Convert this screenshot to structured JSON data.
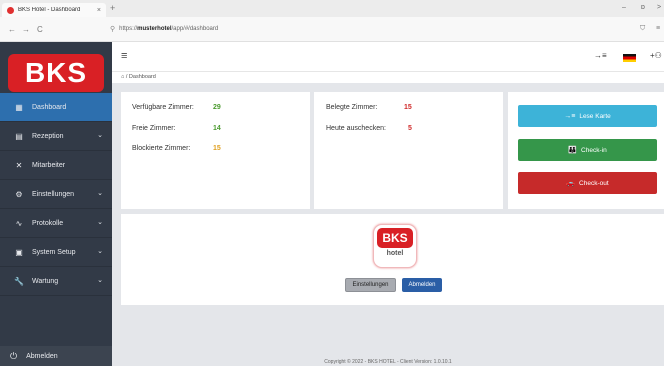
{
  "browser": {
    "tab_title": "BKS Hotel - Dashboard",
    "tab_close": "×",
    "new_tab": "+",
    "url_prefix": "https://",
    "url_host": "musterhotel",
    "url_path": "/app/#/dashboard",
    "back": "←",
    "forward": "→",
    "reload": "C",
    "minimize": "–",
    "restore": "ɒ",
    "close": ">",
    "shield": "⛉",
    "menu": "≡"
  },
  "sidebar": {
    "logo_text": "BKS",
    "items": [
      {
        "label": "Dashboard",
        "icon": "▦",
        "has_children": false,
        "active": true
      },
      {
        "label": "Rezeption",
        "icon": "▤",
        "has_children": true,
        "active": false
      },
      {
        "label": "Mitarbeiter",
        "icon": "✕",
        "has_children": false,
        "active": false
      },
      {
        "label": "Einstellungen",
        "icon": "⚙",
        "has_children": true,
        "active": false
      },
      {
        "label": "Protokolle",
        "icon": "∿",
        "has_children": true,
        "active": false
      },
      {
        "label": "System Setup",
        "icon": "▣",
        "has_children": true,
        "active": false
      },
      {
        "label": "Wartung",
        "icon": "🔧",
        "has_children": true,
        "active": false
      }
    ],
    "chevron": "⌄",
    "logout_label": "Abmelden",
    "logout_icon": "⏻"
  },
  "topbar": {
    "hamburger": "≡",
    "login_icon": "→≡",
    "user_icon": "+⚇"
  },
  "breadcrumb": {
    "home_icon": "⌂",
    "text": "/ Dashboard"
  },
  "stats_left": [
    {
      "label": "Verfügbare Zimmer:",
      "value": "29",
      "color": "#4a9a2e"
    },
    {
      "label": "Freie Zimmer:",
      "value": "14",
      "color": "#4a9a2e"
    },
    {
      "label": "Blockierte Zimmer:",
      "value": "15",
      "color": "#e0a020"
    }
  ],
  "stats_right": [
    {
      "label": "Belegte Zimmer:",
      "value": "15",
      "color": "#d02828"
    },
    {
      "label": "Heute auschecken:",
      "value": "5",
      "color": "#d02828"
    }
  ],
  "actions": [
    {
      "label": "Lese Karte",
      "icon": "→≡",
      "color": "#3db3d8"
    },
    {
      "label": "Check-in",
      "icon": "👪",
      "color": "#35964a"
    },
    {
      "label": "Check-out",
      "icon": "🚗",
      "color": "#c62a2a"
    }
  ],
  "center_logo": {
    "bks": "BKS",
    "hotel": "hotel"
  },
  "buttons": {
    "settings_label": "Einstellungen",
    "logout_label": "Abmelden"
  },
  "footer": {
    "text": "Copyright © 2022 - BKS HOTEL - Client Version: 1.0.10.1"
  }
}
